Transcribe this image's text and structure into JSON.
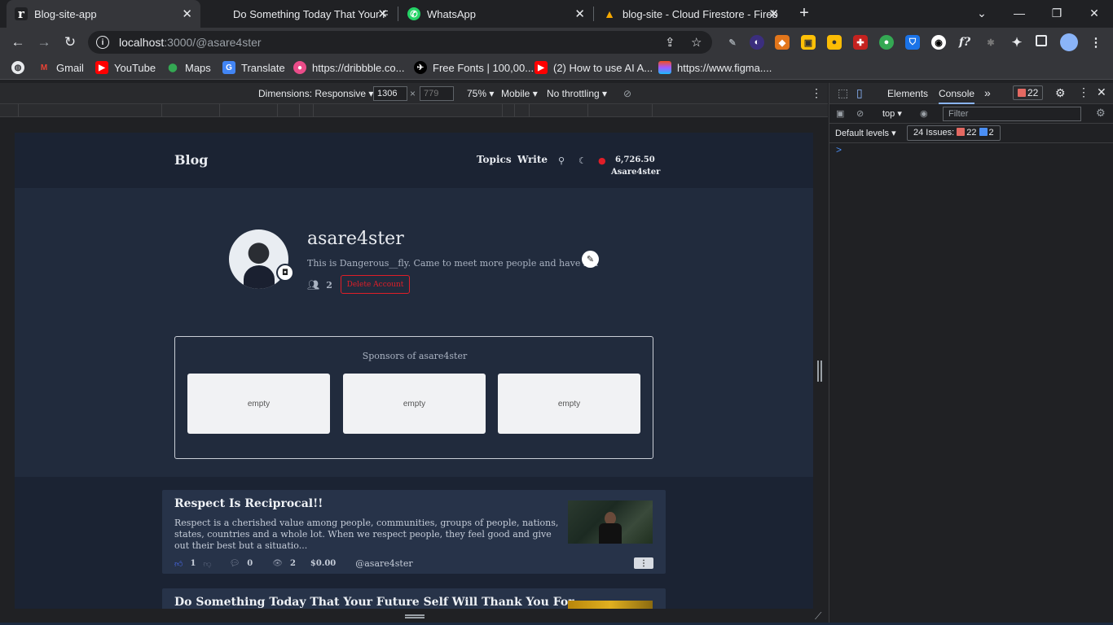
{
  "browser": {
    "tabs": [
      {
        "title": "Blog-site-app",
        "icon": "r-logo-icon",
        "active": true
      },
      {
        "title": "Do Something Today That Your F",
        "icon": "page-icon",
        "active": false
      },
      {
        "title": "WhatsApp",
        "icon": "whatsapp-icon",
        "active": false
      },
      {
        "title": "blog-site - Cloud Firestore - Fireb",
        "icon": "firebase-icon",
        "active": false
      }
    ],
    "url_host": "localhost",
    "url_rest": ":3000/@asare4ster",
    "bookmarks": [
      {
        "label": "Gmail",
        "icon": "gmail-icon"
      },
      {
        "label": "YouTube",
        "icon": "youtube-icon"
      },
      {
        "label": "Maps",
        "icon": "maps-icon"
      },
      {
        "label": "Translate",
        "icon": "translate-icon"
      },
      {
        "label": "https://dribbble.co...",
        "icon": "dribbble-icon"
      },
      {
        "label": "Free Fonts | 100,00...",
        "icon": "fonts-icon"
      },
      {
        "label": "(2) How to use AI A...",
        "icon": "youtube-icon"
      },
      {
        "label": "https://www.figma....",
        "icon": "figma-icon"
      }
    ]
  },
  "device_toolbar": {
    "dimensions_label": "Dimensions: Responsive",
    "width": "1306",
    "height": "779",
    "zoom": "75%",
    "device": "Mobile",
    "throttling": "No throttling"
  },
  "devtools": {
    "tabs": [
      "Elements",
      "Console"
    ],
    "active_tab": "Console",
    "error_count": "22",
    "context": "top",
    "filter_placeholder": "Filter",
    "levels": "Default levels",
    "issues_label": "24 Issues:",
    "issues_errors": "22",
    "issues_info": "2",
    "prompt": ">"
  },
  "site": {
    "logo": "Blog",
    "nav": {
      "topics": "Topics",
      "write": "Write"
    },
    "balance": "6,726.50",
    "username": "Asare4ster"
  },
  "profile": {
    "name": "asare4ster",
    "bio": "This is Dangerous__fly. Came to meet more people and have fun",
    "followers": "2",
    "delete_label": "Delete Account"
  },
  "sponsors": {
    "title": "Sponsors of asare4ster",
    "slots": [
      "empty",
      "empty",
      "empty"
    ]
  },
  "posts": [
    {
      "title": "Respect Is Reciprocal!!",
      "excerpt": "Respect is a cherished value among people, communities, groups of people, nations, states, countries and a whole lot. When we respect people, they feel good and give out their best but a situatio...",
      "likes": "1",
      "comments": "0",
      "views": "2",
      "earnings": "$0.00",
      "author": "@asare4ster"
    },
    {
      "title": "Do Something Today That Your Future Self Will Thank You For.."
    }
  ]
}
